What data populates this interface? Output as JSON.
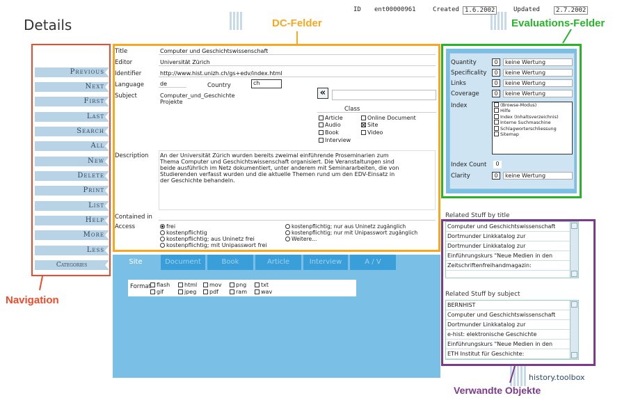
{
  "page": {
    "title": "Details",
    "id_label": "ID",
    "id_value": "ent00000961",
    "created_label": "Created",
    "created_value": "1.6.2002",
    "updated_label": "Updated",
    "updated_value": "2.7.2002",
    "footer": "history.toolbox"
  },
  "annotations": {
    "dc": "DC-Felder",
    "eval": "Evaluations-Felder",
    "nav": "Navigation",
    "related": "Verwandte Objekte"
  },
  "nav": {
    "items": [
      "Previous",
      "Next",
      "First",
      "Last",
      "Search",
      "All",
      "New",
      "Delete",
      "Print",
      "List",
      "Help",
      "More",
      "Less",
      "Categories"
    ]
  },
  "dc": {
    "title_label": "Title",
    "title_value": "Computer und Geschichtswissenschaft",
    "editor_label": "Editor",
    "editor_value": "Universität Zürich",
    "identifier_label": "Identifier",
    "identifier_value": "http://www.hist.unizh.ch/gs+edv/index.html",
    "language_label": "Language",
    "language_value": "de",
    "country_label": "Country",
    "country_value": "ch",
    "subject_label": "Subject",
    "subject_lines": [
      "Computer_und_Geschichte",
      "Projekte"
    ],
    "subject_button": "«",
    "class_label": "Class",
    "class_options": [
      {
        "label": "Article",
        "checked": false
      },
      {
        "label": "Online Document",
        "checked": false
      },
      {
        "label": "Audio",
        "checked": false
      },
      {
        "label": "Site",
        "checked": true
      },
      {
        "label": "Book",
        "checked": false
      },
      {
        "label": "Video",
        "checked": false
      },
      {
        "label": "Interview",
        "checked": false
      }
    ],
    "description_label": "Description",
    "description_lines": [
      "An der Universität Zürich wurden bereits zweimal einführende Proseminarien zum",
      "Thema Computer und Geschichtswissenschaft organisiert. Die Veranstaltungen sind",
      "beide ausführlich im Netz dokumentiert, unter anderem mit Seminararbeiten, die von",
      "Studierenden verfasst wurden und die aktuelle Themen rund um den EDV-Einsatz in",
      "der Geschichte behandeln."
    ],
    "contained_label": "Contained in",
    "access_label": "Access",
    "access_left": [
      {
        "label": "frei",
        "selected": true
      },
      {
        "label": "kostenpflichtig",
        "selected": false
      },
      {
        "label": "kostenpflichtig; aus Uninetz frei",
        "selected": false
      },
      {
        "label": "kostenpflichtig; mit Unipasswort frei",
        "selected": false
      }
    ],
    "access_right": [
      {
        "label": "kostenpflichtig; nur aus Uninetz zugänglich",
        "selected": false
      },
      {
        "label": "kostenpflichtig; nur mit Unipasswort zugänglich",
        "selected": false
      },
      {
        "label": "Weitere...",
        "selected": false
      }
    ]
  },
  "tabs": [
    "Site",
    "Document",
    "Book",
    "Article",
    "Interview",
    "A / V"
  ],
  "format": {
    "label": "Format",
    "row1": [
      "flash",
      "html",
      "mov",
      "png",
      "txt"
    ],
    "row2": [
      "gif",
      "jpeg",
      "pdf",
      "ram",
      "wav"
    ]
  },
  "eval": {
    "rows": [
      {
        "label": "Quantity",
        "num": "0",
        "text": "keine Wertung"
      },
      {
        "label": "Specificality",
        "num": "0",
        "text": "keine Wertung"
      },
      {
        "label": "Links",
        "num": "0",
        "text": "keine Wertung"
      },
      {
        "label": "Coverage",
        "num": "0",
        "text": "keine Wertung"
      }
    ],
    "index_label": "Index",
    "index_items": [
      "(Browse-Modus)",
      "Hilfe",
      "Index (Inhaltsverzeichnis)",
      "Interne Suchmaschine",
      "Schlagworterschliessung",
      "Sitemap"
    ],
    "index_count_label": "Index Count",
    "index_count_value": "0",
    "clarity_label": "Clarity",
    "clarity_num": "0",
    "clarity_text": "keine Wertung"
  },
  "related": {
    "by_title_label": "Related Stuff by title",
    "by_title": [
      "Computer und Geschichtswissenschaft",
      "Dortmunder Linkkatalog zur",
      "Dortmunder Linkkatalog zur",
      "Einführungskurs \"Neue Medien in den",
      "Zeitschriftenfreihandmagazin:"
    ],
    "by_subject_label": "Related Stuff by subject",
    "by_subject": [
      "BERNHIST",
      "Computer und Geschichtswissenschaft",
      "Dortmunder Linkkatalog zur",
      "e-hist: elektronische Geschichte",
      "Einführungskurs \"Neue Medien in den",
      "ETH Institut für Geschichte:"
    ]
  },
  "colors": {
    "nav_frame": "#f04a2a",
    "dc_frame": "#f7a823",
    "eval_frame": "#28b42a",
    "related_frame": "#7b3a8a",
    "panel_blue": "#7ac0e6",
    "tab_blue": "#3a9fd8"
  }
}
